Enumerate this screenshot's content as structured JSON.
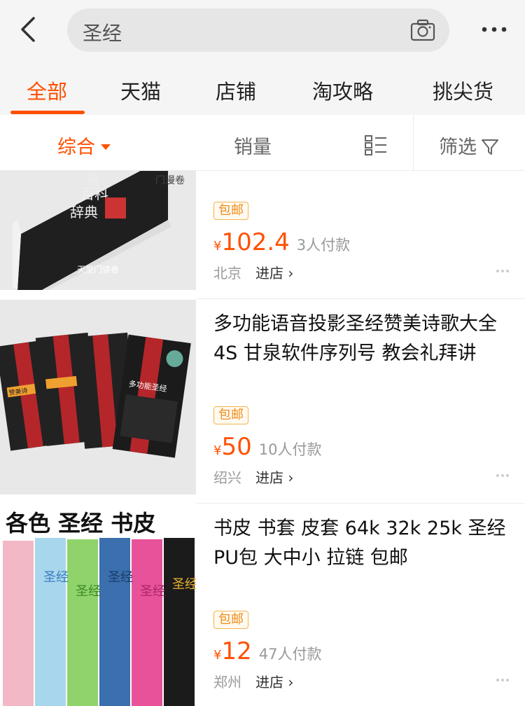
{
  "search": {
    "query": "圣经"
  },
  "tabs": [
    {
      "label": "全部",
      "active": true
    },
    {
      "label": "天猫"
    },
    {
      "label": "店铺"
    },
    {
      "label": "淘攻略"
    },
    {
      "label": "挑尖货"
    }
  ],
  "sort": {
    "comprehensive": "综合",
    "sales": "销量",
    "filter": "筛选"
  },
  "products": [
    {
      "title": "",
      "badge": "包邮",
      "currency": "¥",
      "price": "102.4",
      "sold": "3人付款",
      "location": "北京",
      "enter_store": "进店"
    },
    {
      "title": "多功能语音投影圣经赞美诗歌大全4S 甘泉软件序列号 教会礼拜讲",
      "badge": "包邮",
      "currency": "¥",
      "price": "50",
      "sold": "10人付款",
      "location": "绍兴",
      "enter_store": "进店"
    },
    {
      "title": "书皮  书套 皮套 64k 32k 25k 圣经PU包 大中小 拉链 包邮",
      "badge": "包邮",
      "currency": "¥",
      "price": "12",
      "sold": "47人付款",
      "location": "郑州",
      "enter_store": "进店"
    }
  ],
  "thumb_text": {
    "p1_book": "百科\n辞典",
    "p1_book_top": "经",
    "p1_store": "天堂门读卷",
    "p2_card": "多功能圣经",
    "p2_card2": "赞美诗",
    "p3_heading": "各色 圣经 书皮",
    "p3_cover": "圣经"
  },
  "colors": {
    "accent": "#ff5000",
    "badge": "#f08b16"
  }
}
